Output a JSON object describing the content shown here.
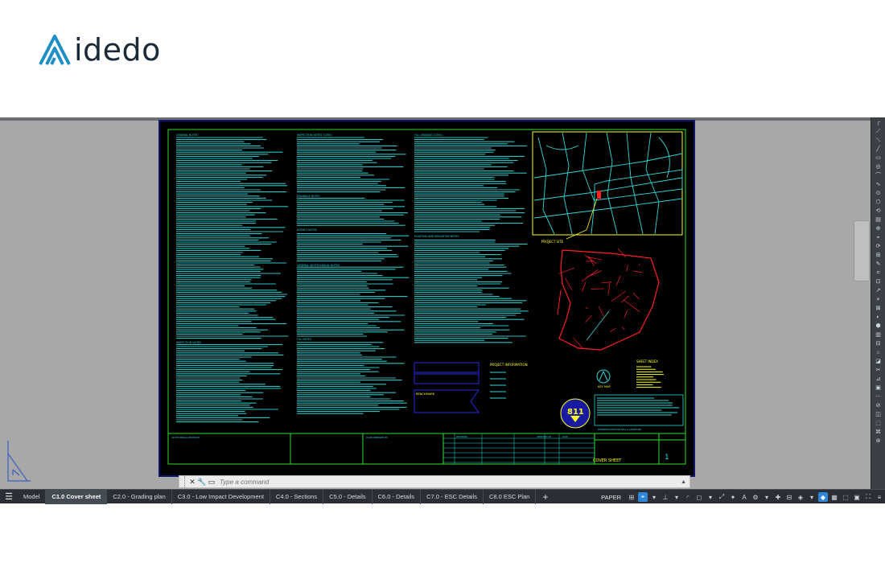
{
  "logo": {
    "brand_text": "idedo",
    "brand_color": "#1d8fc6"
  },
  "sheet": {
    "title": "COVER SHEET",
    "sheet_number": "1",
    "notes_headings": [
      "GENERAL NOTES",
      "INSPECTION NOTES (CONT.)",
      "FILL GRADING (CONT.)",
      "DRAINAGE NOTES",
      "AGENCY NOTES",
      "GENERAL GEOTECHNICAL NOTES",
      "FILL NOTES",
      "PLANTING AND IRRIGATION NOTES",
      "INSPECTION NOTES"
    ],
    "vicinity_label": "PROJECT SITE",
    "project_info_heading": "PROJECT INFORMATION",
    "benchmark_label": "BENCHMARK",
    "key_map_label": "KEY MAP",
    "sheet_index_heading": "SHEET INDEX",
    "badge_text": "811",
    "title_block_labels": [
      "GEOTECHNICAL REVIEW BY",
      "PLANS PREPARED BY",
      "REVISIONS",
      "APPROVED BY",
      "DATE",
      "ENGINEER/SURVEYOR SEAL & SIGNATURE"
    ]
  },
  "command_line": {
    "placeholder": "Type a command"
  },
  "layout_tabs": [
    {
      "label": "Model",
      "active": false
    },
    {
      "label": "C1.0 Cover sheet",
      "active": true
    },
    {
      "label": "C2.0 - Grading plan",
      "active": false
    },
    {
      "label": "C3.0 - Low Impact Development",
      "active": false
    },
    {
      "label": "C4.0 - Sections",
      "active": false
    },
    {
      "label": "C5.0 - Details",
      "active": false
    },
    {
      "label": "C6.0 - Details",
      "active": false
    },
    {
      "label": "C7.0 - ESC Details",
      "active": false
    },
    {
      "label": "C8.0 ESC Plan",
      "active": false
    }
  ],
  "add_layout_label": "+",
  "status": {
    "space_label": "PAPER"
  },
  "colors": {
    "cyan": "#2fd8d8",
    "green": "#2ce02c",
    "yellow": "#ffff1e",
    "red": "#ff2020",
    "blue": "#2a2ae0",
    "accent": "#2f86d6"
  }
}
